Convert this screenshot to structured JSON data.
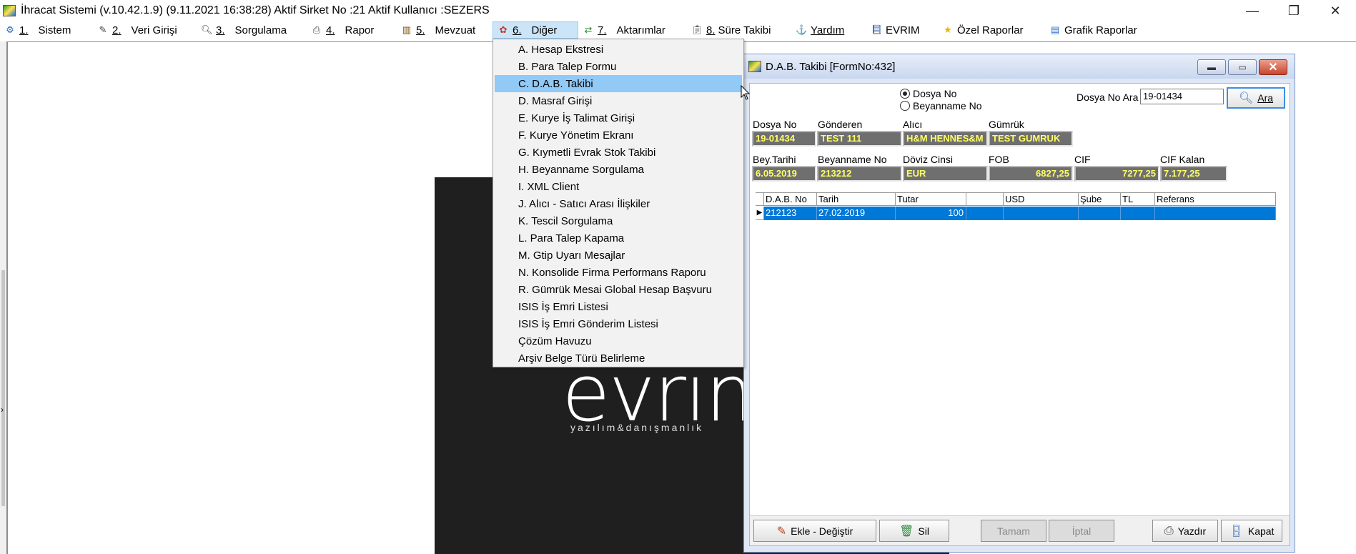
{
  "titlebar": {
    "title": "İhracat Sistemi (v.10.42.1.9) (9.11.2021 16:38:28) Aktif Sirket No :21 Aktif Kullanıcı :SEZERS",
    "minimize": "—",
    "restore": "❐",
    "close": "✕"
  },
  "menubar": {
    "items": [
      {
        "num": "1.",
        "label": "Sistem",
        "icon": "system-icon"
      },
      {
        "num": "2.",
        "label": "Veri Girişi",
        "icon": "data-entry-icon"
      },
      {
        "num": "3.",
        "label": "Sorgulama",
        "icon": "query-icon"
      },
      {
        "num": "4.",
        "label": "Rapor",
        "icon": "printer-icon"
      },
      {
        "num": "5.",
        "label": "Mevzuat",
        "icon": "books-icon"
      },
      {
        "num": "6.",
        "label": "Diğer",
        "icon": "other-icon"
      },
      {
        "num": "7.",
        "label": "Aktarımlar",
        "icon": "transfer-icon"
      },
      {
        "num": "8.",
        "label": "Süre Takibi",
        "icon": "clipboard-icon"
      },
      {
        "num": "",
        "label": "Yardım",
        "icon": "help-icon"
      },
      {
        "num": "",
        "label": "EVRIM",
        "icon": "book-icon"
      },
      {
        "num": "",
        "label": "Özel Raporlar",
        "icon": "star-icon"
      },
      {
        "num": "",
        "label": "Grafik Raporlar",
        "icon": "chart-icon"
      }
    ]
  },
  "dropdown": {
    "items": [
      "A.   Hesap Ekstresi",
      "B.   Para Talep Formu",
      "C.   D.A.B. Takibi",
      "D.   Masraf Girişi",
      "E.   Kurye İş Talimat Girişi",
      "F.   Kurye Yönetim Ekranı",
      "G.   Kıymetli Evrak Stok Takibi",
      "H.   Beyanname Sorgulama",
      "I.    XML Client",
      "J.   Alıcı - Satıcı Arası İlişkiler",
      "K.  Tescil Sorgulama",
      "L. Para Talep Kapama",
      "M. Gtip Uyarı Mesajlar",
      "N. Konsolide Firma Performans Raporu",
      "R. Gümrük Mesai Global Hesap Başvuru",
      "ISIS İş Emri Listesi",
      "ISIS İş Emri Gönderim Listesi",
      "Çözüm Havuzu",
      "Arşiv Belge Türü Belirleme"
    ]
  },
  "logo": {
    "text": "evrim",
    "tagline": "yazılım&danışmanlık"
  },
  "dab": {
    "title": "D.A.B. Takibi [FormNo:432]",
    "radio_dosya": "Dosya No",
    "radio_beyanname": "Beyanname No",
    "search_label": "Dosya No Ara",
    "search_value": "19-01434",
    "search_button": "Ara",
    "labels": {
      "dosya_no": "Dosya No",
      "gonderen": "Gönderen",
      "alici": "Alıcı",
      "gumruk": "Gümrük",
      "bey_tarihi": "Bey.Tarihi",
      "beyanname_no": "Beyanname No",
      "doviz_cinsi": "Döviz Cinsi",
      "fob": "FOB",
      "cif": "CIF",
      "cif_kalan": "CIF Kalan"
    },
    "values": {
      "dosya_no": "19-01434",
      "gonderen": "TEST 111",
      "alici": "H&M HENNES&M",
      "gumruk": "TEST GUMRUK",
      "bey_tarihi": "6.05.2019",
      "beyanname_no": "213212",
      "doviz_cinsi": "EUR",
      "fob": "6827,25",
      "cif": "7277,25",
      "cif_kalan": "7.177,25"
    },
    "grid": {
      "columns": [
        "D.A.B. No",
        "Tarih",
        "Tutar",
        "",
        "USD",
        "Şube",
        "TL",
        "Referans"
      ],
      "rows": [
        [
          "212123",
          "27.02.2019",
          "100",
          "",
          "",
          "",
          "",
          ""
        ]
      ]
    },
    "buttons": {
      "ekle": "Ekle - Değiştir",
      "sil": "Sil",
      "tamam": "Tamam",
      "iptal": "İptal",
      "yazdir": "Yazdır",
      "kapat": "Kapat"
    }
  }
}
